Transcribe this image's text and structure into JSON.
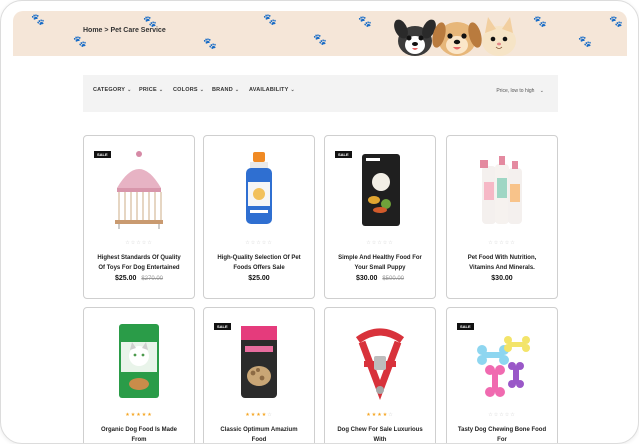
{
  "breadcrumb": {
    "home": "Home",
    "separator": ">",
    "current": "Pet Care Service"
  },
  "filters": [
    {
      "label": "CATEGORY"
    },
    {
      "label": "PRICE"
    },
    {
      "label": "COLORS"
    },
    {
      "label": "BRAND"
    },
    {
      "label": "AVAILABILITY"
    }
  ],
  "sort": {
    "label": "Price, low to high"
  },
  "products": [
    {
      "title": "Highest Standards Of Quality Of Toys For Dog Entertained",
      "price": "$25.00",
      "old_price": "$270.00",
      "badge": "SALE",
      "rating": 0,
      "icon": "birdcage-image"
    },
    {
      "title": "High-Quality Selection Of Pet Foods Offers Sale",
      "price": "$25.00",
      "old_price": "",
      "badge": "",
      "rating": 0,
      "icon": "pet-shampoo-bottle-image"
    },
    {
      "title": "Simple And Healthy Food For Your Small Puppy",
      "price": "$30.00",
      "old_price": "$500.00",
      "badge": "SALE",
      "rating": 0,
      "icon": "puppy-food-bag-image"
    },
    {
      "title": "Pet Food With Nutrition, Vitamins And Minerals.",
      "price": "$30.00",
      "old_price": "",
      "badge": "",
      "rating": 0,
      "icon": "pet-care-bottles-image"
    },
    {
      "title": "Organic Dog Food Is Made From",
      "price": "",
      "old_price": "",
      "badge": "",
      "rating": 5,
      "icon": "cat-food-bag-image"
    },
    {
      "title": "Classic Optimum Amazium Food",
      "price": "",
      "old_price": "",
      "badge": "SALE",
      "rating": 4,
      "icon": "treat-pouch-image"
    },
    {
      "title": "Dog Chew For Sale Luxurious With",
      "price": "",
      "old_price": "",
      "badge": "",
      "rating": 4,
      "icon": "dog-harness-image"
    },
    {
      "title": "Tasty Dog Chewing Bone Food For",
      "price": "",
      "old_price": "",
      "badge": "SALE",
      "rating": 0,
      "icon": "chew-bone-toys-image"
    }
  ]
}
